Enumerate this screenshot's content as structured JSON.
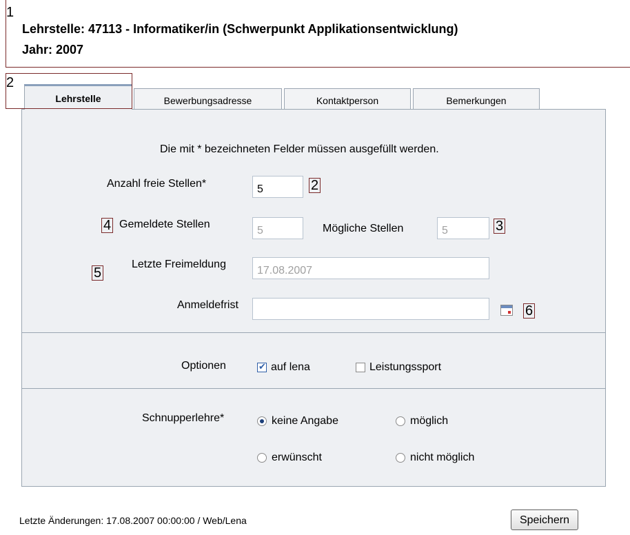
{
  "header": {
    "marker": "1",
    "title": "Lehrstelle: 47113 - Informatiker/in (Schwerpunkt Applikationsentwicklung)",
    "year": "Jahr: 2007"
  },
  "tabs": [
    {
      "label": "Lehrstelle",
      "active": true
    },
    {
      "label": "Bewerbungsadresse",
      "active": false
    },
    {
      "label": "Kontaktperson",
      "active": false
    },
    {
      "label": "Bemerkungen",
      "active": false
    }
  ],
  "tabs_marker": "2",
  "form": {
    "hint": "Die mit * bezeichneten Felder müssen ausgefüllt werden.",
    "anzahl_label": "Anzahl freie Stellen*",
    "anzahl_value": "5",
    "anzahl_marker": "2",
    "gemeldete_marker": "4",
    "gemeldete_label": "Gemeldete Stellen",
    "gemeldete_value": "5",
    "moegliche_label": "Mögliche Stellen",
    "moegliche_value": "5",
    "moegliche_marker": "3",
    "freimeldung_marker": "5",
    "freimeldung_label": "Letzte Freimeldung",
    "freimeldung_value": "17.08.2007",
    "anmeldefrist_label": "Anmeldefrist",
    "anmeldefrist_value": "",
    "calendar_marker": "6"
  },
  "options": {
    "label": "Optionen",
    "items": [
      {
        "label": "auf lena",
        "checked": true
      },
      {
        "label": "Leistungssport",
        "checked": false
      }
    ]
  },
  "schnupper": {
    "label": "Schnupperlehre*",
    "choices": [
      {
        "label": "keine Angabe",
        "selected": true
      },
      {
        "label": "möglich",
        "selected": false
      },
      {
        "label": "erwünscht",
        "selected": false
      },
      {
        "label": "nicht möglich",
        "selected": false
      }
    ]
  },
  "footer": {
    "last_change": "Letzte Änderungen: 17.08.2007 00:00:00 / Web/Lena",
    "save_label": "Speichern"
  }
}
